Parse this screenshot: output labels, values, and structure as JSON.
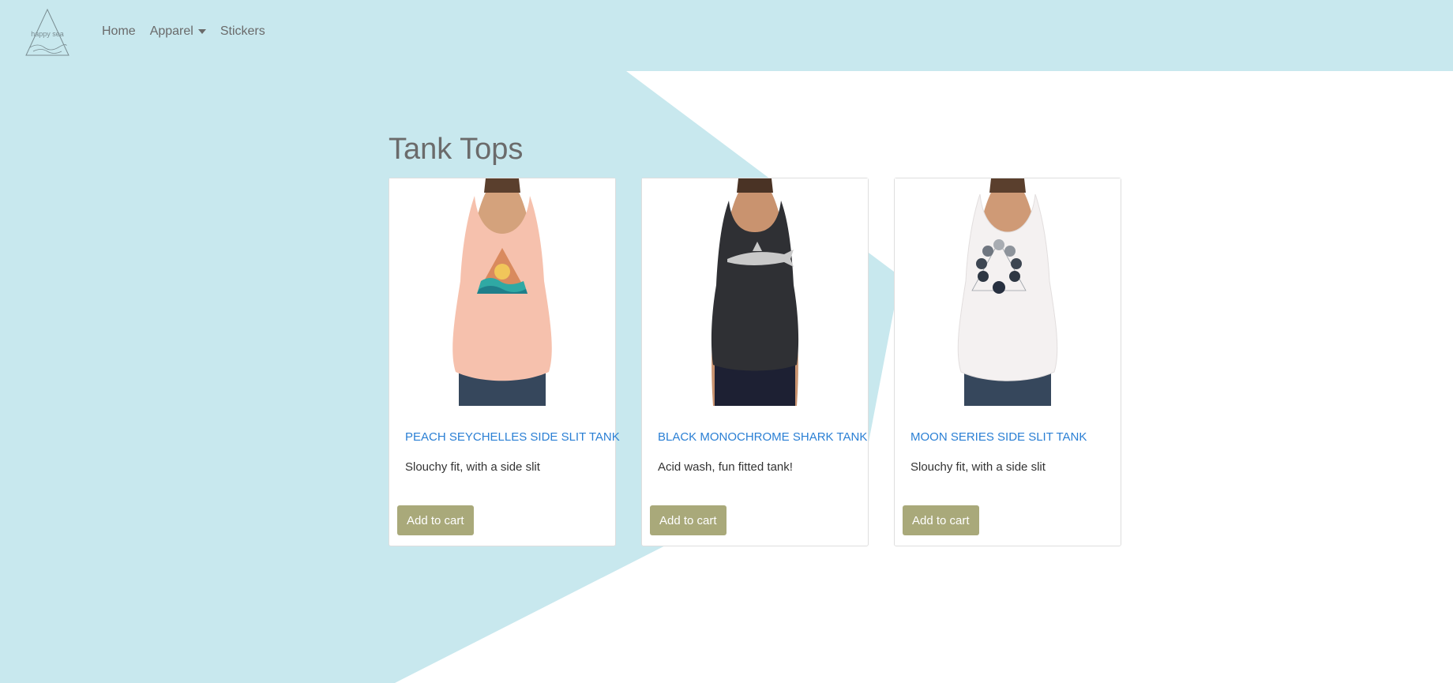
{
  "brand": {
    "logo_text": "happy sea"
  },
  "nav": {
    "items": [
      {
        "label": "Home"
      },
      {
        "label": "Apparel"
      },
      {
        "label": "Stickers"
      }
    ]
  },
  "page": {
    "title": "Tank Tops"
  },
  "products": [
    {
      "name": "PEACH SEYCHELLES SIDE SLIT TANK",
      "description": "Slouchy fit, with a side slit",
      "button": "Add to cart",
      "shirt_color": "#f6c1ad",
      "graphic": "triangle-waves-icon"
    },
    {
      "name": "BLACK MONOCHROME SHARK TANK",
      "description": "Acid wash, fun fitted tank!",
      "button": "Add to cart",
      "shirt_color": "#2f3034",
      "graphic": "shark-icon"
    },
    {
      "name": "MOON SERIES SIDE SLIT TANK",
      "description": "Slouchy fit, with a side slit",
      "button": "Add to cart",
      "shirt_color": "#f4f1f1",
      "graphic": "moon-phases-icon"
    }
  ],
  "colors": {
    "background_blue": "#c8e8ee",
    "link_blue": "#2a7fd4",
    "button_olive": "#a9a97a",
    "nav_text": "#6a6a6a"
  }
}
